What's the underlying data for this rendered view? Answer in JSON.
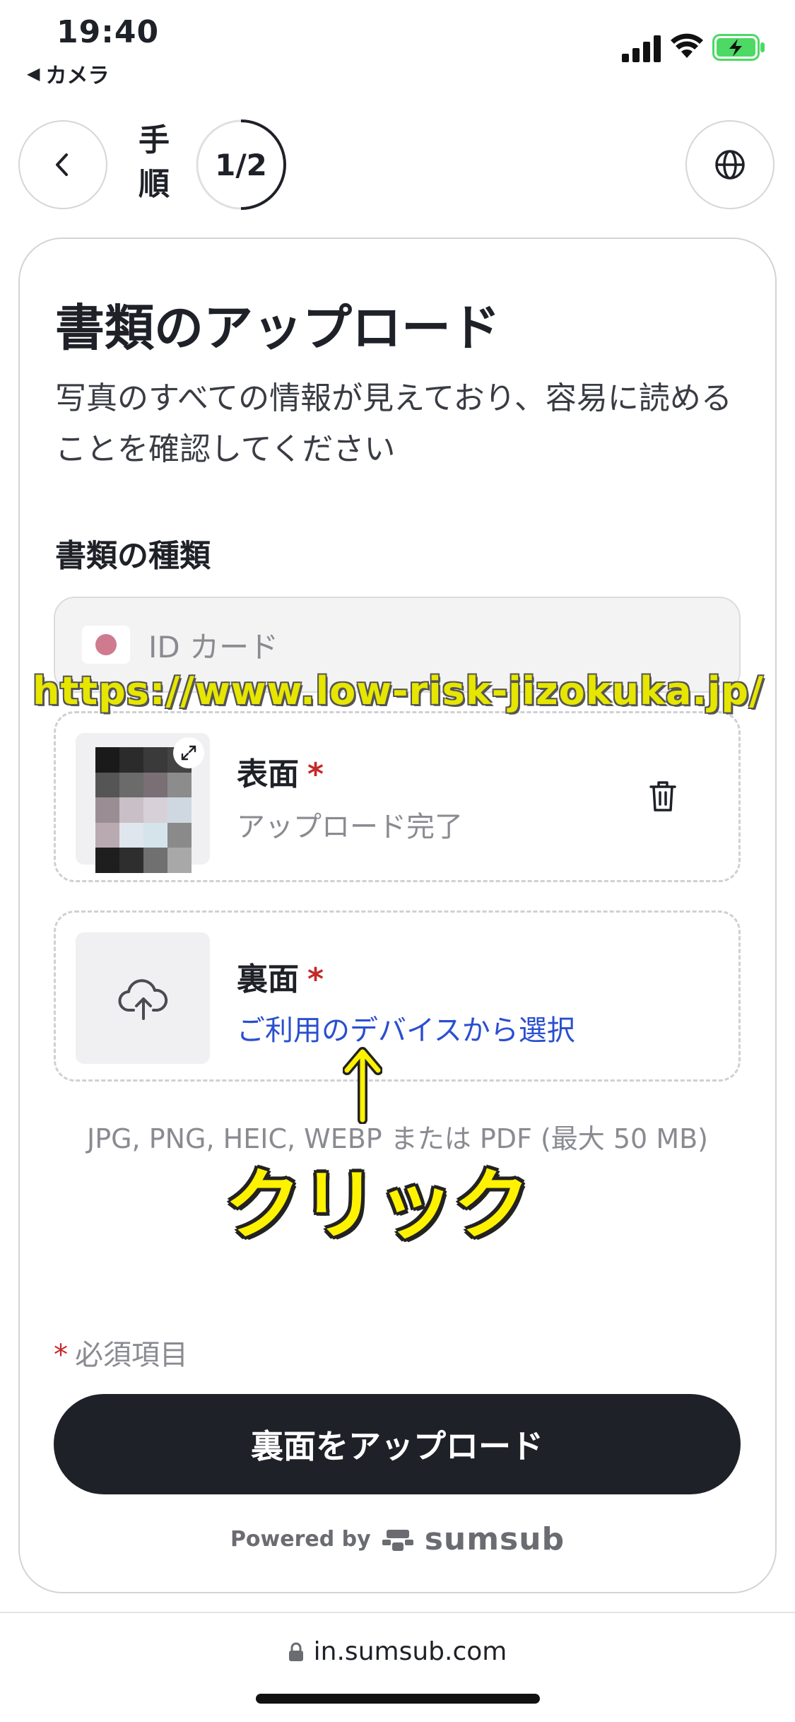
{
  "status_bar": {
    "time": "19:40",
    "back_app": "カメラ",
    "battery_color": "#4cd964"
  },
  "header": {
    "steps_label": "手順",
    "step_progress": "1/2",
    "progress_fraction": 0.5
  },
  "card": {
    "title": "書類のアップロード",
    "subtitle": "写真のすべての情報が見えており、容易に読めることを確認してください",
    "doc_type_label": "書類の種類",
    "doc_type_value": "ID カード",
    "front": {
      "title": "表面",
      "required_mark": "*",
      "status": "アップロード完了"
    },
    "back": {
      "title": "裏面",
      "required_mark": "*",
      "select_link": "ご利用のデバイスから選択"
    },
    "formats_note": "JPG, PNG, HEIC, WEBP または PDF (最大 50 MB)",
    "required_note": "必須項目",
    "required_mark": "*",
    "submit_label": "裏面をアップロード",
    "powered_by": "Powered by",
    "brand": "sumsub"
  },
  "annotations": {
    "watermark": "https://www.low-risk-jizokuka.jp/",
    "click_label": "クリック",
    "color": "#fff200"
  },
  "browser": {
    "url": "in.sumsub.com"
  },
  "colors": {
    "primary_dark": "#1f2128",
    "link": "#2a4fcf",
    "required": "#c62828"
  }
}
